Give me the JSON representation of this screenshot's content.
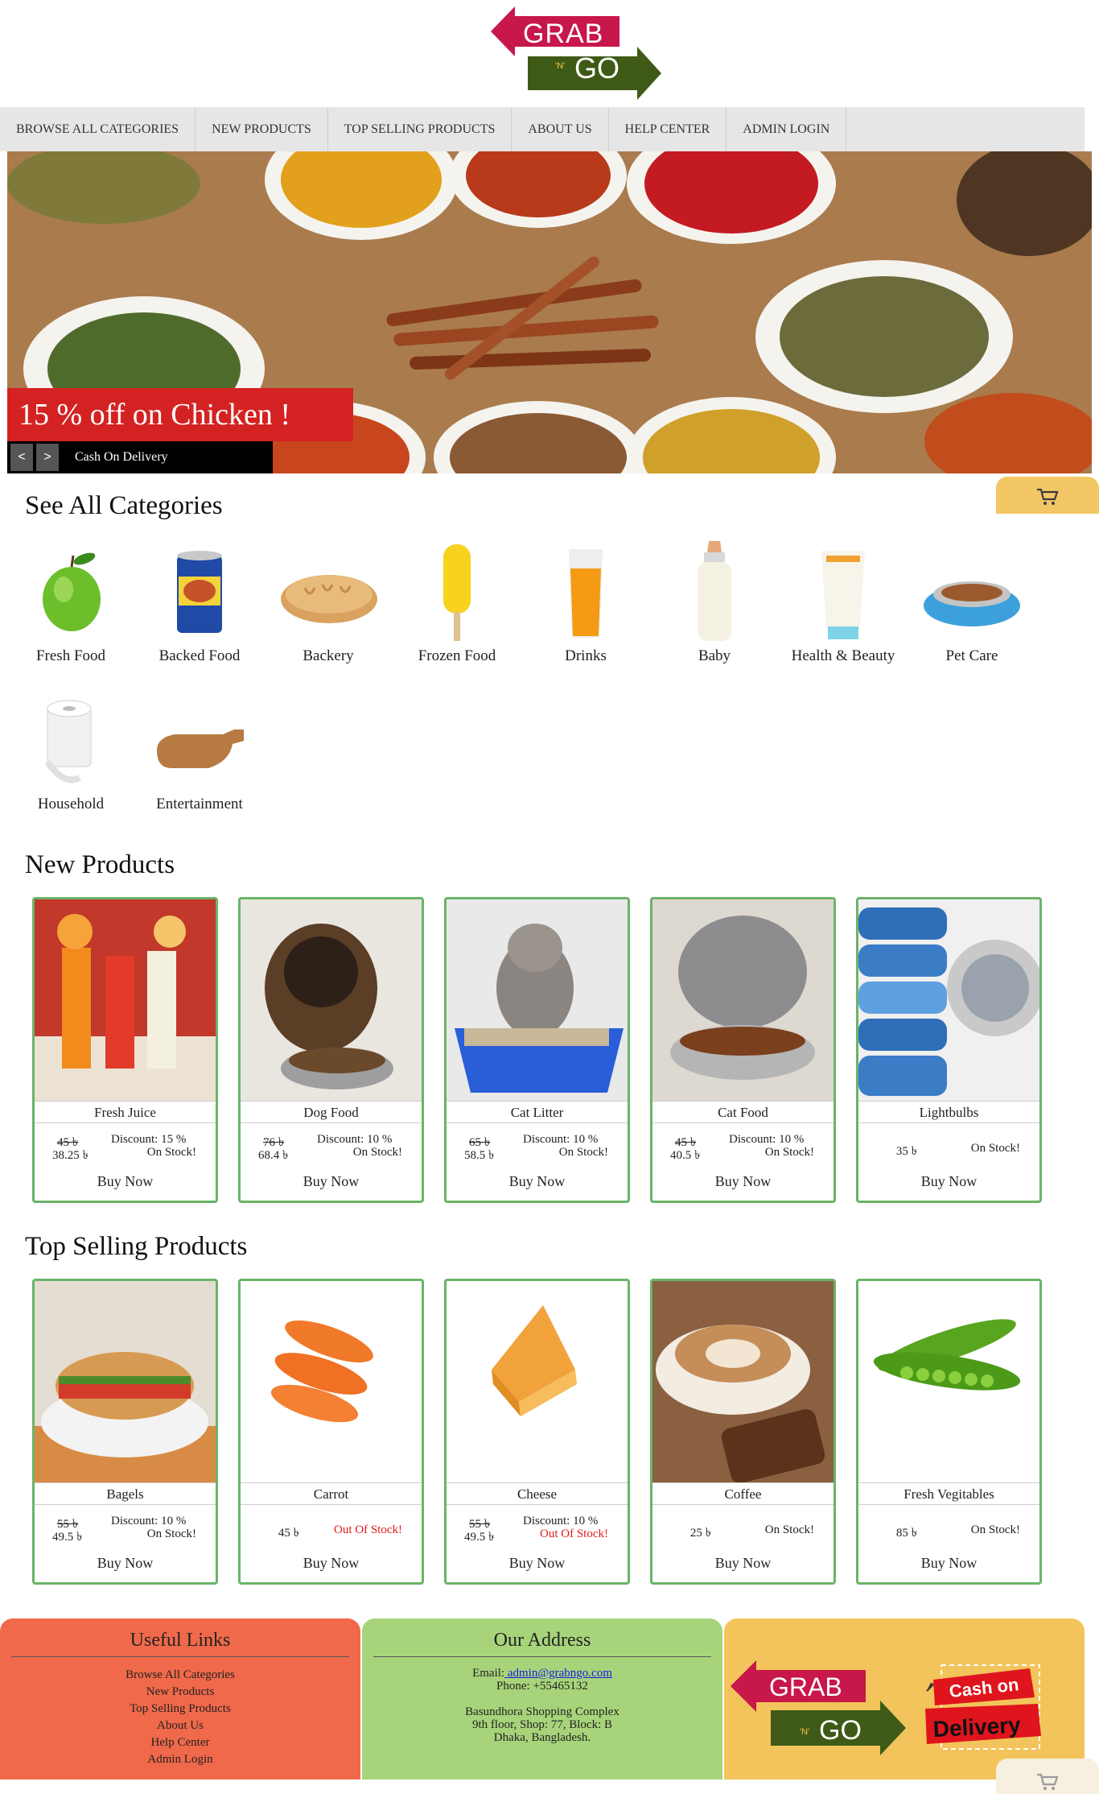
{
  "header": {
    "logo_top": "GRAB",
    "logo_mid": "'N'",
    "logo_bottom": "GO"
  },
  "nav": [
    {
      "label": "BROWSE ALL CATEGORIES"
    },
    {
      "label": "NEW PRODUCTS"
    },
    {
      "label": "TOP SELLING PRODUCTS"
    },
    {
      "label": "ABOUT US"
    },
    {
      "label": "HELP CENTER"
    },
    {
      "label": "ADMIN LOGIN"
    }
  ],
  "banner": {
    "promo": "15 % off on Chicken !",
    "prev": "<",
    "next": ">",
    "caption": "Cash On Delivery"
  },
  "categories_title": "See All Categories",
  "categories": [
    {
      "label": "Fresh Food",
      "icon": "apple"
    },
    {
      "label": "Backed Food",
      "icon": "canned-beans"
    },
    {
      "label": "Backery",
      "icon": "bread"
    },
    {
      "label": "Frozen Food",
      "icon": "popsicle"
    },
    {
      "label": "Drinks",
      "icon": "juice-glass"
    },
    {
      "label": "Baby",
      "icon": "baby-bottle"
    },
    {
      "label": "Health & Beauty",
      "icon": "cream-tube"
    },
    {
      "label": "Pet Care",
      "icon": "pet-bowl"
    },
    {
      "label": "Household",
      "icon": "toilet-roll"
    },
    {
      "label": "Entertainment",
      "icon": "cutting-board"
    }
  ],
  "new_products_title": "New Products",
  "new_products": [
    {
      "name": "Fresh Juice",
      "old_price": "45 ৳",
      "price": "38.25 ৳",
      "discount": "Discount: 15 %",
      "stock": "On Stock!",
      "buy": "Buy Now"
    },
    {
      "name": "Dog Food",
      "old_price": "76 ৳",
      "price": "68.4 ৳",
      "discount": "Discount: 10 %",
      "stock": "On Stock!",
      "buy": "Buy Now"
    },
    {
      "name": "Cat Litter",
      "old_price": "65 ৳",
      "price": "58.5 ৳",
      "discount": "Discount: 10 %",
      "stock": "On Stock!",
      "buy": "Buy Now"
    },
    {
      "name": "Cat Food",
      "old_price": "45 ৳",
      "price": "40.5 ৳",
      "discount": "Discount: 10 %",
      "stock": "On Stock!",
      "buy": "Buy Now"
    },
    {
      "name": "Lightbulbs",
      "price": "35 ৳",
      "stock": "On Stock!",
      "buy": "Buy Now"
    }
  ],
  "top_selling_title": "Top Selling Products",
  "top_selling": [
    {
      "name": "Bagels",
      "old_price": "55 ৳",
      "price": "49.5 ৳",
      "discount": "Discount: 10 %",
      "stock": "On Stock!",
      "buy": "Buy Now"
    },
    {
      "name": "Carrot",
      "price": "45 ৳",
      "stock": "Out Of Stock!",
      "buy": "Buy Now"
    },
    {
      "name": "Cheese",
      "old_price": "55 ৳",
      "price": "49.5 ৳",
      "discount": "Discount: 10 %",
      "stock": "Out Of Stock!",
      "buy": "Buy Now"
    },
    {
      "name": "Coffee",
      "price": "25 ৳",
      "stock": "On Stock!",
      "buy": "Buy Now"
    },
    {
      "name": "Fresh Vegitables",
      "price": "85 ৳",
      "stock": "On Stock!",
      "buy": "Buy Now"
    }
  ],
  "footer": {
    "links_title": "Useful Links",
    "links": [
      "Browse All Categories",
      "New Products",
      "Top Selling Products",
      "About Us",
      "Help Center",
      "Admin Login"
    ],
    "address_title": "Our Address",
    "email_label": "Email:",
    "email": " admin@grabngo.com",
    "phone": "Phone: +55465132",
    "address_1": "Basundhora Shopping Complex",
    "address_2": "9th floor, Shop: 77, Block: B",
    "address_3": "Dhaka, Bangladesh.",
    "badge_top": "Cash on",
    "badge_bottom": "Delivery"
  },
  "colors": {
    "nav_bg": "#e6e6e6",
    "promo_red": "#d42222",
    "card_border": "#6ab468",
    "out_of_stock": "#e31b1b",
    "footer_links": "#f0694a",
    "footer_address": "#a7d47a",
    "footer_logo": "#f3c45b",
    "logo_red": "#c8174a",
    "logo_green": "#3f5a16"
  }
}
